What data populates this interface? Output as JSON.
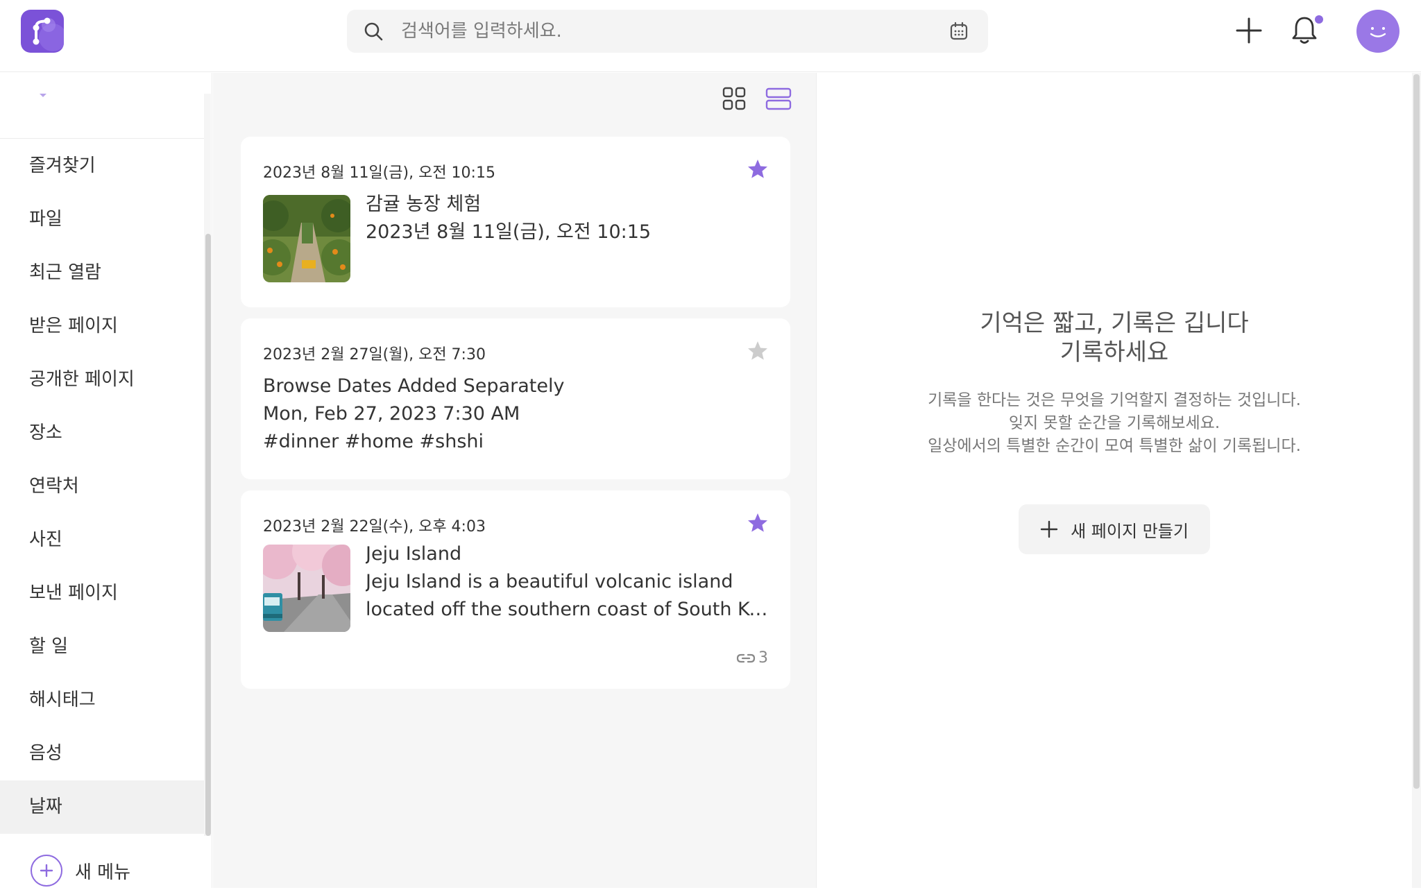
{
  "header": {
    "search_placeholder": "검색어를 입력하세요."
  },
  "sidebar": {
    "items": [
      {
        "label": "즐겨찾기"
      },
      {
        "label": "파일"
      },
      {
        "label": "최근 열람"
      },
      {
        "label": "받은 페이지"
      },
      {
        "label": "공개한 페이지"
      },
      {
        "label": "장소"
      },
      {
        "label": "연락처"
      },
      {
        "label": "사진"
      },
      {
        "label": "보낸 페이지"
      },
      {
        "label": "할 일"
      },
      {
        "label": "해시태그"
      },
      {
        "label": "음성"
      },
      {
        "label": "날짜",
        "active": true
      }
    ],
    "new_menu_label": "새 메뉴"
  },
  "cards": [
    {
      "date": "2023년 8월 11일(금), 오전 10:15",
      "starred": true,
      "title": "감귤 농장 체험",
      "lines": [
        "2023년 8월 11일(금), 오전 10:15"
      ]
    },
    {
      "date": "2023년 2월 27일(월), 오전 7:30",
      "starred": false,
      "title": "Browse Dates Added Separately",
      "lines": [
        "Mon, Feb 27, 2023 7:30 AM",
        "#dinner #home #shshi"
      ]
    },
    {
      "date": "2023년 2월 22일(수), 오후 4:03",
      "starred": true,
      "title": "Jeju Island",
      "lines": [
        "Jeju Island is a beautiful volcanic island",
        "located off the southern coast of South Korea."
      ],
      "link_count": "3"
    }
  ],
  "empty_state": {
    "title_line1": "기억은 짧고, 기록은 깁니다",
    "title_line2": "기록하세요",
    "desc_line1": "기록을 한다는 것은 무엇을 기억할지 결정하는 것입니다.",
    "desc_line2": "잊지 못할 순간을 기록해보세요.",
    "desc_line3": "일상에서의 특별한 순간이 모여 특별한 삶이 기록됩니다.",
    "button_label": "새 페이지 만들기"
  },
  "colors": {
    "accent": "#8e6be0",
    "logo": "#7b52d8",
    "star_on": "#8e6be0",
    "star_off": "#cccccc"
  }
}
